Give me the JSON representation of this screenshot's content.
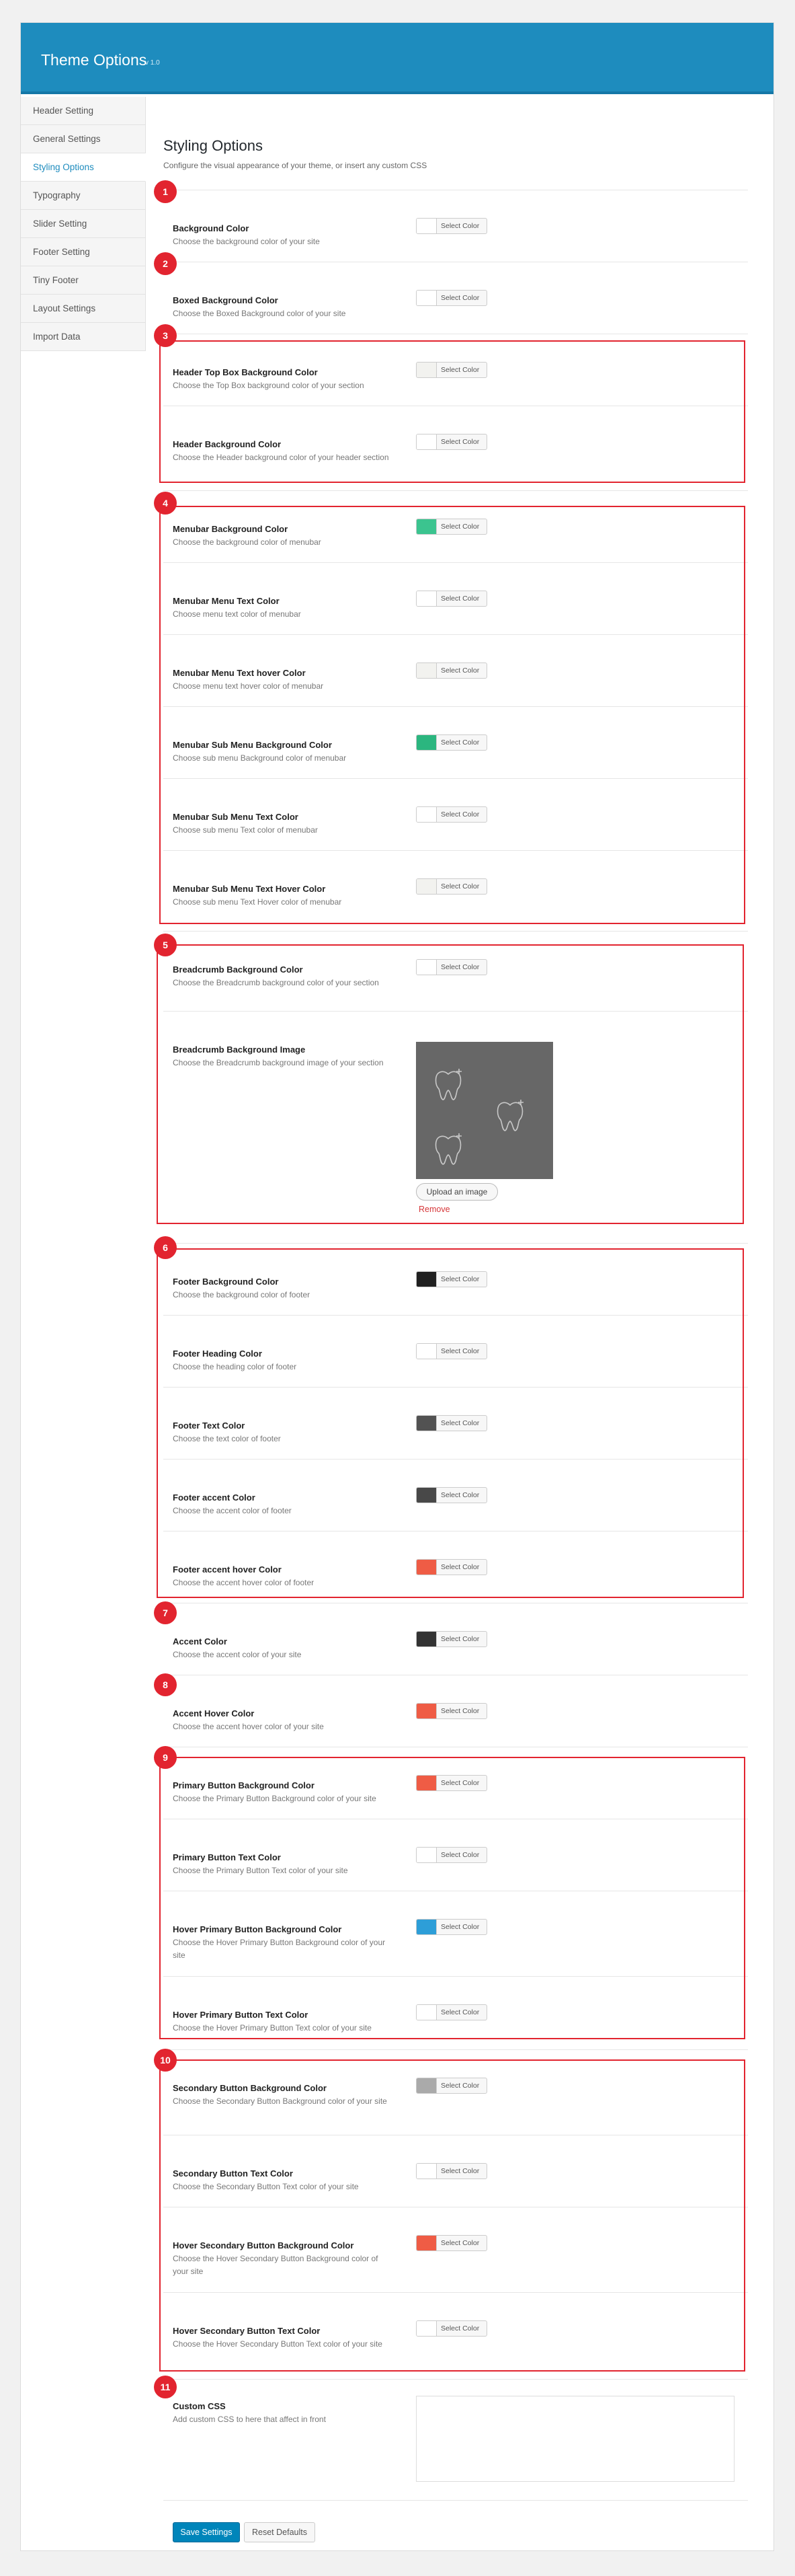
{
  "header": {
    "title": "Theme Options",
    "version": "v 1.0"
  },
  "sidebar": {
    "items": [
      {
        "label": "Header Setting",
        "active": false
      },
      {
        "label": "General Settings",
        "active": false
      },
      {
        "label": "Styling Options",
        "active": true
      },
      {
        "label": "Typography",
        "active": false
      },
      {
        "label": "Slider Setting",
        "active": false
      },
      {
        "label": "Footer Setting",
        "active": false
      },
      {
        "label": "Tiny Footer",
        "active": false
      },
      {
        "label": "Layout Settings",
        "active": false
      },
      {
        "label": "Import Data",
        "active": false
      }
    ]
  },
  "page": {
    "title": "Styling Options",
    "description": "Configure the visual appearance of your theme, or insert any custom CSS",
    "select_color_label": "Select Color",
    "upload_label": "Upload an image",
    "remove_label": "Remove",
    "custom_css_label": "Custom CSS",
    "custom_css_desc": "Add custom CSS to here that affect in front",
    "save_label": "Save Settings",
    "reset_label": "Reset Defaults"
  },
  "markers": [
    "1",
    "2",
    "3",
    "4",
    "5",
    "6",
    "7",
    "8",
    "9",
    "10",
    "11"
  ],
  "options": [
    {
      "label": "Background Color",
      "desc": "Choose the background color of your site",
      "color": "#ffffff"
    },
    {
      "label": "Boxed Background Color",
      "desc": "Choose the Boxed Background color of your site",
      "color": "#ffffff"
    },
    {
      "label": "Header Top Box Background Color",
      "desc": "Choose the Top Box background color of your section",
      "color": "#f2f2ef"
    },
    {
      "label": "Header Background Color",
      "desc": "Choose the Header background color of your header section",
      "color": "#ffffff"
    },
    {
      "label": "Menubar Background Color",
      "desc": "Choose the background color of menubar",
      "color": "#3bc48f"
    },
    {
      "label": "Menubar Menu Text Color",
      "desc": "Choose menu text color of menubar",
      "color": "#ffffff"
    },
    {
      "label": "Menubar Menu Text hover Color",
      "desc": "Choose menu text hover color of menubar",
      "color": "#f2f2ef"
    },
    {
      "label": "Menubar Sub Menu Background Color",
      "desc": "Choose sub menu Background color of menubar",
      "color": "#2bb67f"
    },
    {
      "label": "Menubar Sub Menu Text Color",
      "desc": "Choose sub menu Text color of menubar",
      "color": "#ffffff"
    },
    {
      "label": "Menubar Sub Menu Text Hover Color",
      "desc": "Choose sub menu Text Hover color of menubar",
      "color": "#f2f2ef"
    },
    {
      "label": "Breadcrumb Background Color",
      "desc": "Choose the Breadcrumb background color of your section",
      "color": "#ffffff"
    },
    {
      "label": "Breadcrumb Background Image",
      "desc": "Choose the Breadcrumb background image of your section"
    },
    {
      "label": "Footer Background Color",
      "desc": "Choose the background color of footer",
      "color": "#202020"
    },
    {
      "label": "Footer Heading Color",
      "desc": "Choose the heading color of footer",
      "color": "#ffffff"
    },
    {
      "label": "Footer Text Color",
      "desc": "Choose the text color of footer",
      "color": "#525252"
    },
    {
      "label": "Footer accent Color",
      "desc": "Choose the accent color of footer",
      "color": "#484848"
    },
    {
      "label": "Footer accent hover Color",
      "desc": "Choose the accent hover color of footer",
      "color": "#ef5c45"
    },
    {
      "label": "Accent Color",
      "desc": "Choose the accent color of your site",
      "color": "#333333"
    },
    {
      "label": "Accent Hover Color",
      "desc": "Choose the accent hover color of your site",
      "color": "#ef5c45"
    },
    {
      "label": "Primary Button Background Color",
      "desc": "Choose the Primary Button Background color of your site",
      "color": "#ef5c45"
    },
    {
      "label": "Primary Button Text Color",
      "desc": "Choose the Primary Button Text color of your site",
      "color": "#ffffff"
    },
    {
      "label": "Hover Primary Button Background Color",
      "desc": "Choose the Hover Primary Button Background color of your site",
      "color": "#2d9ed8"
    },
    {
      "label": "Hover Primary Button Text Color",
      "desc": "Choose the Hover Primary Button Text color of your site",
      "color": "#ffffff"
    },
    {
      "label": "Secondary Button Background Color",
      "desc": "Choose the Secondary Button Background color of your site",
      "color": "#aaaaaa"
    },
    {
      "label": "Secondary Button Text Color",
      "desc": "Choose the Secondary Button Text color of your site",
      "color": "#ffffff"
    },
    {
      "label": "Hover Secondary Button Background Color",
      "desc": "Choose the Hover Secondary Button Background color of your site",
      "color": "#ef5c45"
    },
    {
      "label": "Hover Secondary Button Text Color",
      "desc": "Choose the Hover Secondary Button Text color of your site",
      "color": "#ffffff"
    }
  ]
}
